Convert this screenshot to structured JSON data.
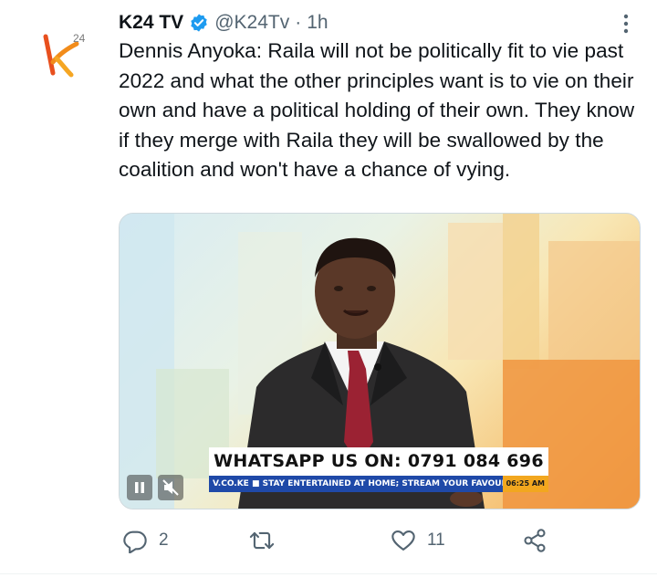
{
  "tweet": {
    "author": {
      "name": "K24 TV",
      "handle": "@K24Tv",
      "verified": true,
      "avatar_text": "k",
      "avatar_superscript": "24"
    },
    "separator": "·",
    "time": "1h",
    "text": "Dennis Anyoka: Raila will not be politically fit to vie past 2022 and what the other principles want is to vie on their own and have a political holding of their own. They know if they merge with Raila they will be swallowed by the coalition and won't have a chance of vying.",
    "media": {
      "banner": "WHATSAPP US ON: 0791 084 696",
      "ticker": "V.CO.KE  ■  STAY ENTERTAINED AT HOME; STREAM YOUR FAVOURITE SI",
      "ticker_time": "06:25 AM"
    },
    "actions": {
      "reply_count": "2",
      "retweet_count": "",
      "like_count": "11"
    }
  },
  "colors": {
    "verified": "#1d9bf0",
    "icon": "#536471",
    "ticker_bg": "#1f49a8",
    "brand_orange": "#f28c1b"
  },
  "icons": [
    "verified-icon",
    "more-icon",
    "pause-icon",
    "mute-icon",
    "reply-icon",
    "retweet-icon",
    "like-icon",
    "share-icon"
  ]
}
